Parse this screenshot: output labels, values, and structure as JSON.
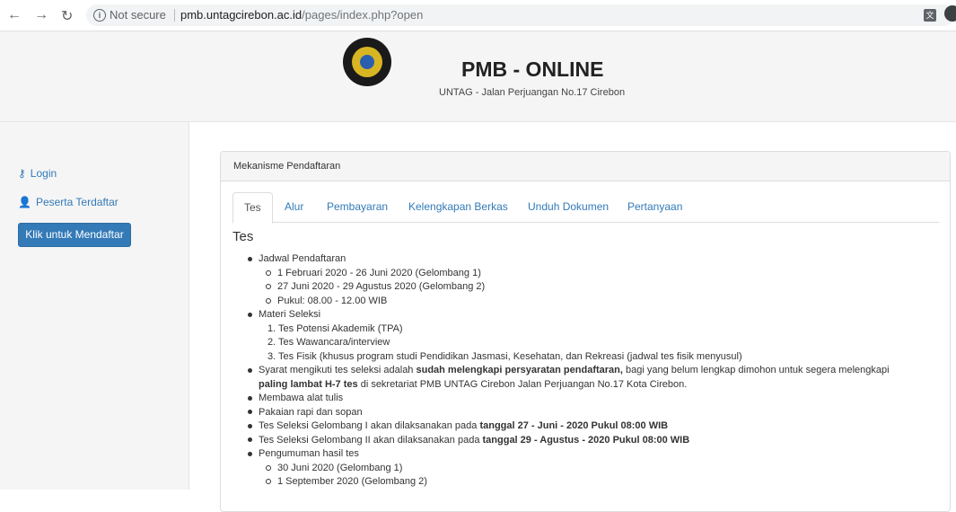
{
  "browser": {
    "not_secure": "Not secure",
    "url_host": "pmb.untagcirebon.ac.id",
    "url_path": "/pages/index.php?open"
  },
  "header": {
    "title": "PMB - ONLINE",
    "subtitle": "UNTAG - Jalan Perjuangan No.17 Cirebon"
  },
  "sidebar": {
    "login": "Login",
    "peserta": "Peserta Terdaftar",
    "daftar_button": "Klik untuk Mendaftar"
  },
  "panel": {
    "heading": "Mekanisme Pendaftaran",
    "tabs": [
      "Tes",
      "Alur",
      "Pembayaran",
      "Kelengkapan Berkas",
      "Unduh Dokumen",
      "Pertanyaan"
    ],
    "active_tab": "Tes",
    "section_title": "Tes",
    "items": {
      "jadwal": "Jadwal Pendaftaran",
      "jadwal_1": "1 Februari 2020 - 26 Juni 2020 (Gelombang 1)",
      "jadwal_2": "27 Juni 2020 - 29 Agustus 2020 (Gelombang 2)",
      "jadwal_3": "Pukul: 08.00 - 12.00 WIB",
      "materi": "Materi Seleksi",
      "materi_1": "1. Tes Potensi Akademik (TPA)",
      "materi_2": "2. Tes Wawancara/interview",
      "materi_3": "3. Tes Fisik (khusus program studi Pendidikan Jasmasi, Kesehatan, dan Rekreasi (jadwal tes fisik menyusul)",
      "syarat_a": "Syarat mengikuti tes seleksi adalah ",
      "syarat_b": "sudah melengkapi persyaratan pendaftaran,",
      "syarat_c": " bagi yang belum lengkap dimohon untuk segera melengkapi",
      "syarat_d": "paling lambat H-7 tes",
      "syarat_e": " di sekretariat PMB UNTAG Cirebon Jalan Perjuangan No.17 Kota Cirebon.",
      "alat": "Membawa alat tulis",
      "pakaian": "Pakaian rapi dan sopan",
      "gel1_a": "Tes Seleksi Gelombang I akan dilaksanakan pada ",
      "gel1_b": "tanggal 27 - Juni - 2020 Pukul 08:00 WIB",
      "gel2_a": "Tes Seleksi Gelombang II akan dilaksanakan pada ",
      "gel2_b": "tanggal 29 - Agustus - 2020 Pukul 08:00 WIB",
      "pengumuman": "Pengumuman hasil tes",
      "pengumuman_1": "30 Juni 2020 (Gelombang 1)",
      "pengumuman_2": "1 September 2020 (Gelombang 2)"
    }
  }
}
